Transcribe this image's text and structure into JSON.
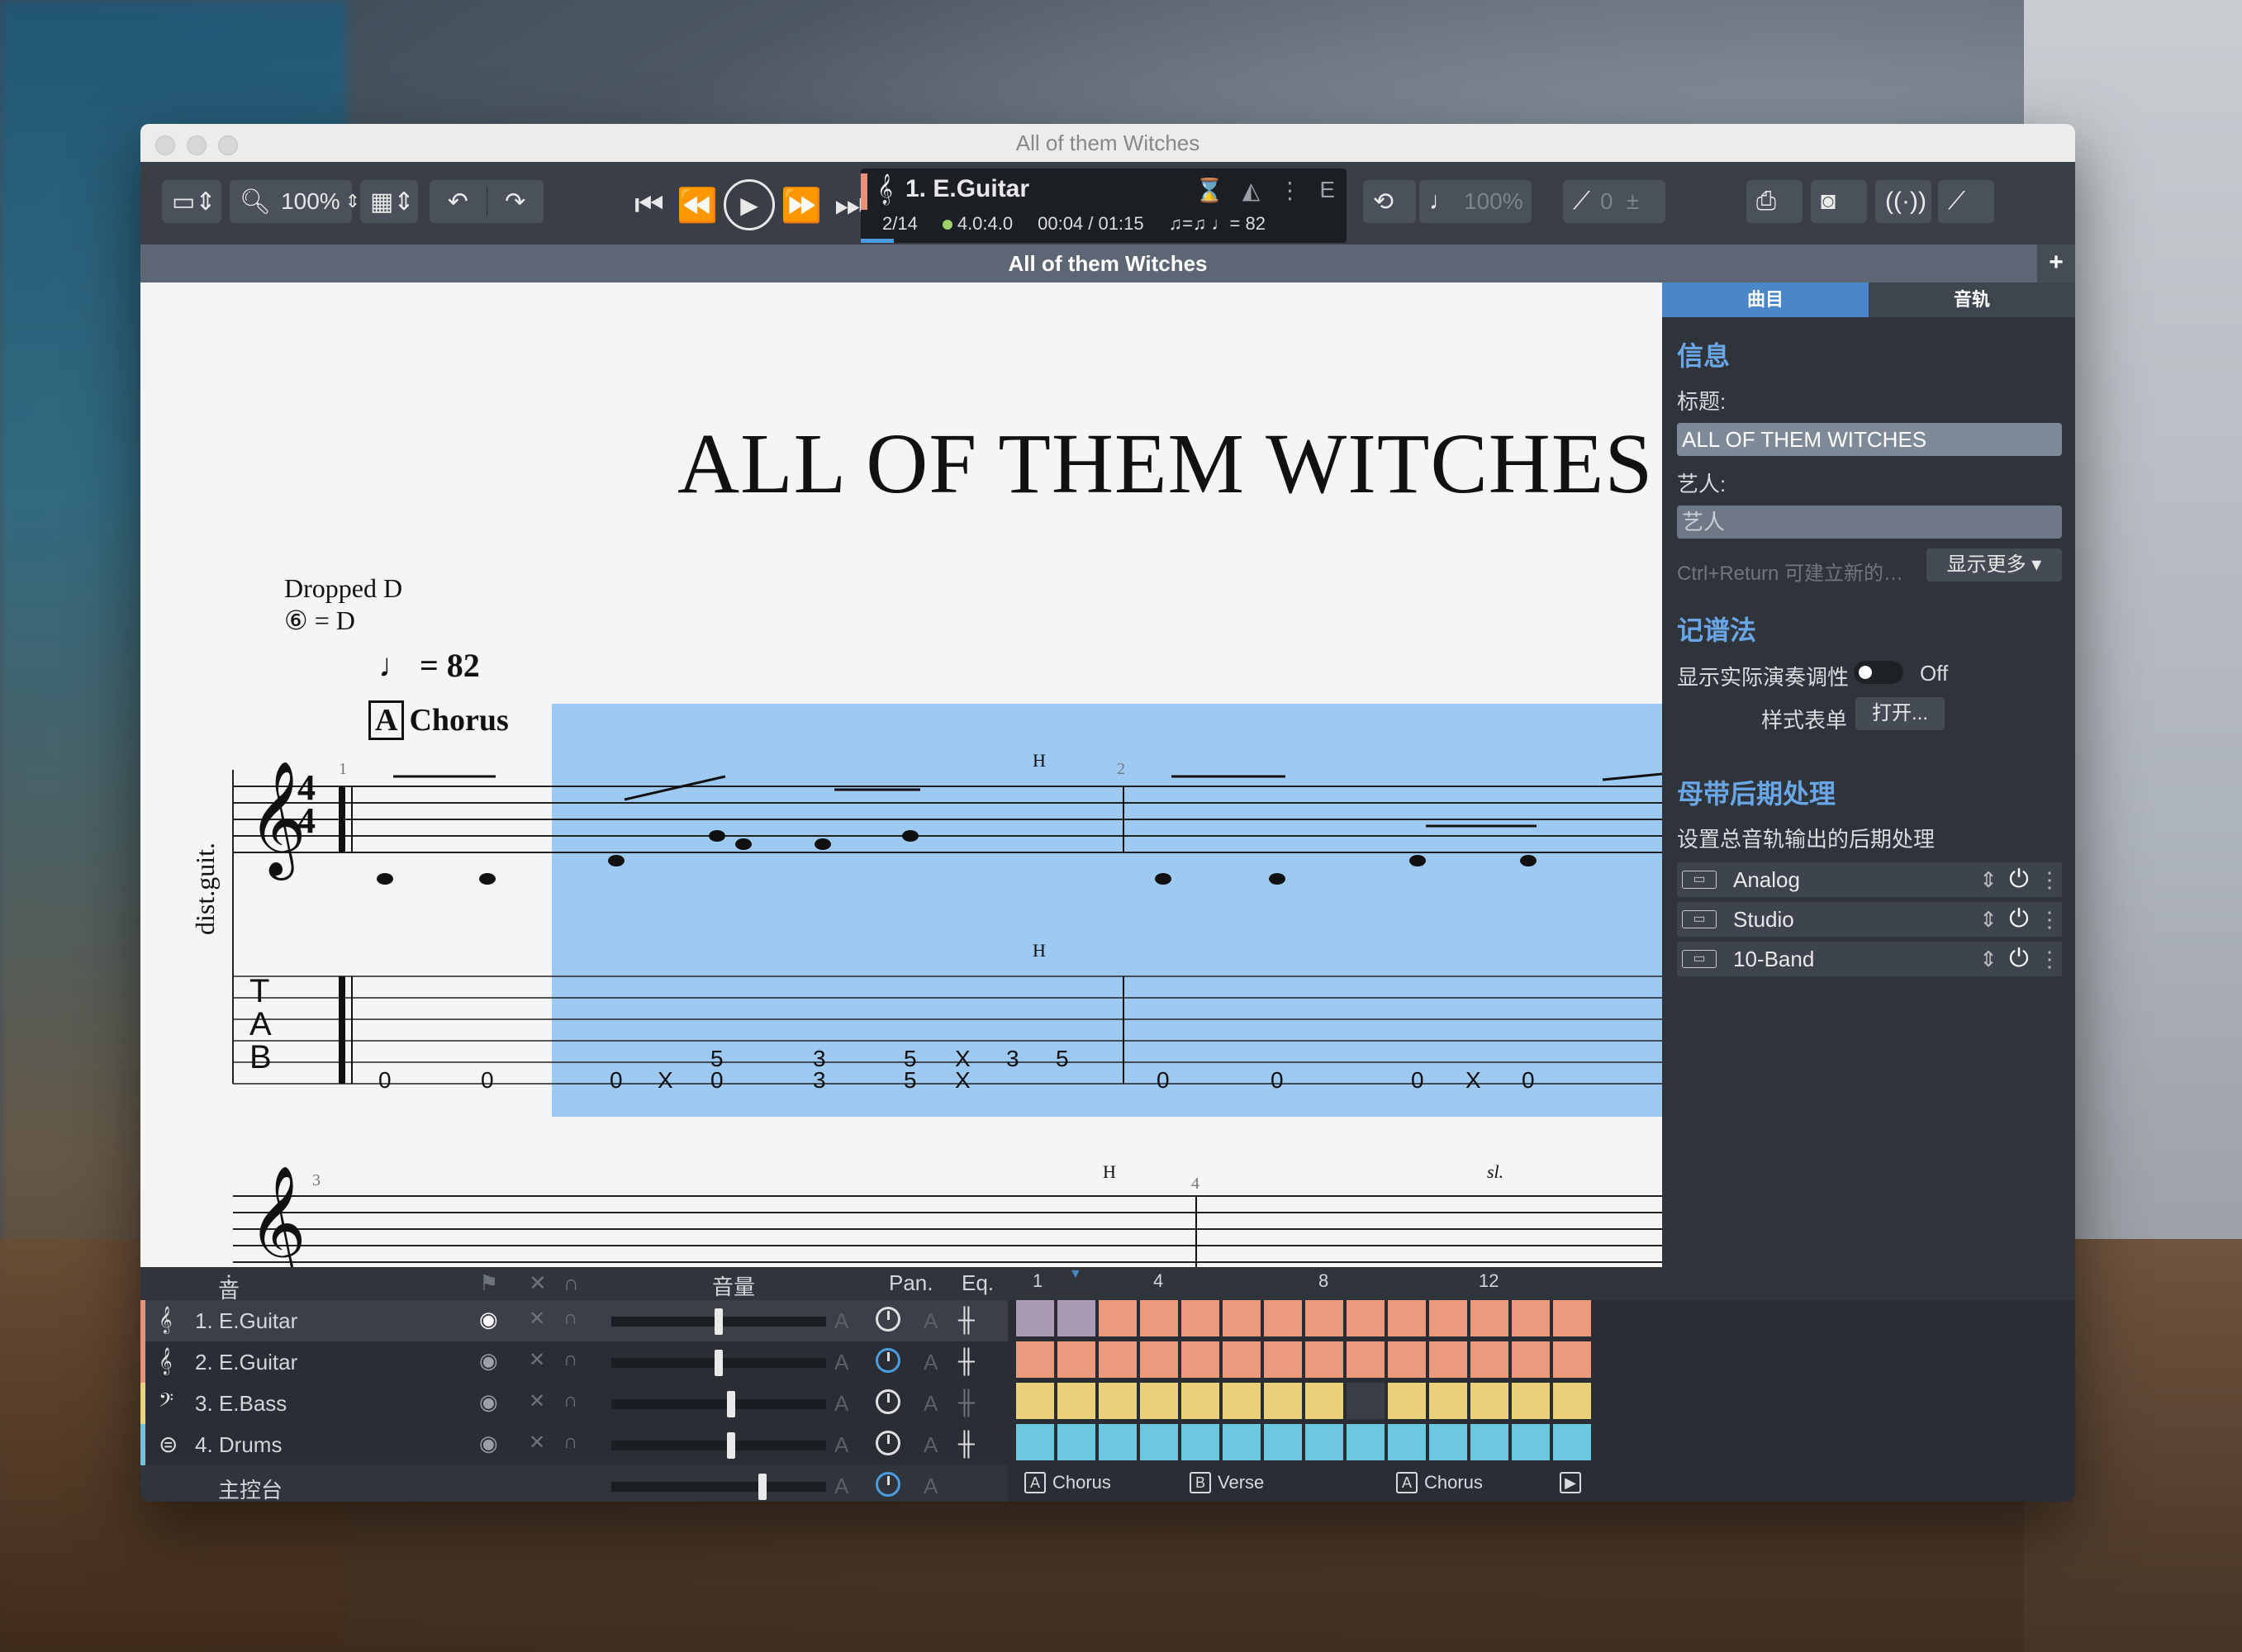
{
  "window": {
    "title": "All of them Witches"
  },
  "toolbar": {
    "zoom": "100%",
    "lcd": {
      "track": "1. E.Guitar",
      "bar": "2/14",
      "signature": "4.0:4.0",
      "time": "00:04 / 01:15",
      "tempo": "= 82",
      "key": "E"
    },
    "speed": "100%",
    "count": "0"
  },
  "tab_title": "All of them Witches",
  "score": {
    "title": "ALL OF THEM WITCHES",
    "tuning_name": "Dropped D",
    "tuning_string": "⑥ = D",
    "tempo_mark": "= 82",
    "section_letter": "A",
    "section_name": "Chorus",
    "instrument": "dist.guit.",
    "bar_numbers": [
      "1",
      "2",
      "3",
      "4"
    ],
    "hammer": "H",
    "slide": "sl.",
    "tab_row1": [
      "0",
      "0",
      "0",
      "X",
      "0",
      "5",
      "3",
      "3",
      "5",
      "5",
      "X",
      "X",
      "3",
      "5",
      "0",
      "0",
      "0",
      "X",
      "0"
    ]
  },
  "panel": {
    "tabs": [
      "曲目",
      "音轨"
    ],
    "info_heading": "信息",
    "title_label": "标题:",
    "title_value": "ALL OF THEM WITCHES",
    "artist_label": "艺人:",
    "artist_placeholder": "艺人",
    "hint": "Ctrl+Return 可建立新的…",
    "show_more": "显示更多",
    "notation_heading": "记谱法",
    "concert_pitch_label": "显示实际演奏调性",
    "concert_pitch_value": "Off",
    "stylesheet_label": "样式表单",
    "stylesheet_button": "打开...",
    "mastering_heading": "母带后期处理",
    "mastering_desc": "设置总音轨输出的后期处理",
    "effects": [
      "Analog",
      "Studio",
      "10-Band"
    ]
  },
  "mixer": {
    "header_tracks": "音轨",
    "header_volume": "音量",
    "header_pan": "Pan.",
    "header_eq": "Eq.",
    "timeline_numbers": [
      "1",
      "4",
      "8",
      "12"
    ],
    "tracks": [
      {
        "name": "1. E.Guitar",
        "color": "#e8907a",
        "volume": 0.5
      },
      {
        "name": "2. E.Guitar",
        "color": "#e8907a",
        "volume": 0.5
      },
      {
        "name": "3. E.Bass",
        "color": "#e8d27a",
        "volume": 0.56
      },
      {
        "name": "4. Drums",
        "color": "#6ec3de",
        "volume": 0.56
      }
    ],
    "master": "主控台",
    "sections": [
      {
        "letter": "A",
        "name": "Chorus"
      },
      {
        "letter": "B",
        "name": "Verse"
      },
      {
        "letter": "A",
        "name": "Chorus"
      }
    ]
  },
  "colors": {
    "guitar": "#ec9a7d",
    "bass": "#e9d27b",
    "drums": "#6cc7e0",
    "selection": "#9dc9f2",
    "accent": "#4a86c8"
  }
}
